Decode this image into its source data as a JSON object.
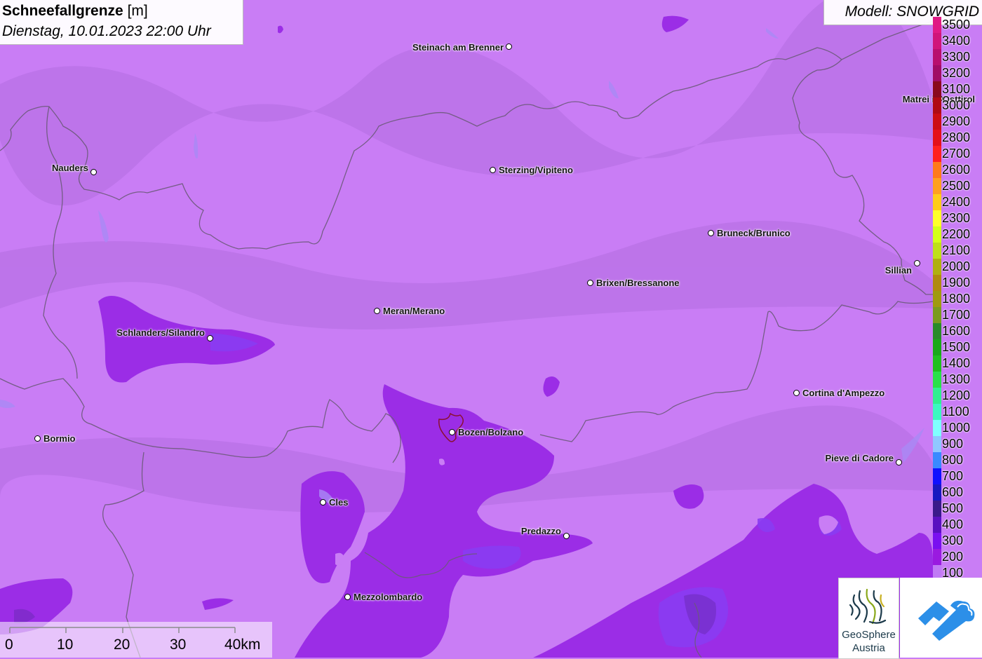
{
  "title": {
    "parameter": "Schneefallgrenze",
    "unit": "[m]",
    "datetime": "Dienstag, 10.01.2023 22:00 Uhr"
  },
  "model": "Modell: SNOWGRID",
  "legend": {
    "top_partial_label": "3500",
    "items": [
      {
        "label": "3400",
        "color": "#d0157a"
      },
      {
        "label": "3300",
        "color": "#b80f6e"
      },
      {
        "label": "3200",
        "color": "#a00c66"
      },
      {
        "label": "3100",
        "color": "#8a0a1e"
      },
      {
        "label": "3000",
        "color": "#b00a14"
      },
      {
        "label": "2900",
        "color": "#cc0d14"
      },
      {
        "label": "2800",
        "color": "#e4101a"
      },
      {
        "label": "2700",
        "color": "#ff2020"
      },
      {
        "label": "2600",
        "color": "#ff7a1a"
      },
      {
        "label": "2500",
        "color": "#ffa020"
      },
      {
        "label": "2400",
        "color": "#ffcc1a"
      },
      {
        "label": "2300",
        "color": "#ffff2a"
      },
      {
        "label": "2200",
        "color": "#d4ff1a"
      },
      {
        "label": "2100",
        "color": "#bfe01a"
      },
      {
        "label": "2000",
        "color": "#b0b010"
      },
      {
        "label": "1900",
        "color": "#b08a10"
      },
      {
        "label": "1800",
        "color": "#a09a10"
      },
      {
        "label": "1700",
        "color": "#7a9a20"
      },
      {
        "label": "1600",
        "color": "#2a8a2a"
      },
      {
        "label": "1500",
        "color": "#1aa81a"
      },
      {
        "label": "1400",
        "color": "#20c020"
      },
      {
        "label": "1300",
        "color": "#2ae04a"
      },
      {
        "label": "1200",
        "color": "#30f090"
      },
      {
        "label": "1100",
        "color": "#3cf8c0"
      },
      {
        "label": "1000",
        "color": "#80ffff"
      },
      {
        "label": "900",
        "color": "#90c8ff"
      },
      {
        "label": "800",
        "color": "#3a8aff"
      },
      {
        "label": "700",
        "color": "#1010ff"
      },
      {
        "label": "600",
        "color": "#1818c0"
      },
      {
        "label": "500",
        "color": "#3a1a8a"
      },
      {
        "label": "400",
        "color": "#5a10c0"
      },
      {
        "label": "300",
        "color": "#7a10f0"
      },
      {
        "label": "200",
        "color": "#9a1ae0"
      },
      {
        "label": "100",
        "color": "#c07af5"
      }
    ]
  },
  "towns": [
    {
      "name": "Steinach am Brenner"
    },
    {
      "name": "Nauders"
    },
    {
      "name": "Sterzing/Vipiteno"
    },
    {
      "name": "Matrei in Osttirol"
    },
    {
      "name": "Bruneck/Brunico"
    },
    {
      "name": "Sillian"
    },
    {
      "name": "Brixen/Bressanone"
    },
    {
      "name": "Meran/Merano"
    },
    {
      "name": "Schlanders/Silandro"
    },
    {
      "name": "Cortina d'Ampezzo"
    },
    {
      "name": "Bormio"
    },
    {
      "name": "Bozen/Bolzano"
    },
    {
      "name": "Pieve di Cadore"
    },
    {
      "name": "Cles"
    },
    {
      "name": "Predazzo"
    },
    {
      "name": "Mezzolombardo"
    }
  ],
  "scalebar": {
    "labels": [
      "0",
      "10",
      "20",
      "30",
      "40km"
    ]
  },
  "logos": {
    "geosphere_line1": "GeoSphere",
    "geosphere_line2": "Austria"
  },
  "colors": {
    "background_100": "#c97df5",
    "zone_200": "#9b2de6",
    "zone_300": "#8c3ef0",
    "border": "#6b5a7a",
    "city_outline": "#8a1030",
    "logo_blue": "#2c8fe8"
  }
}
